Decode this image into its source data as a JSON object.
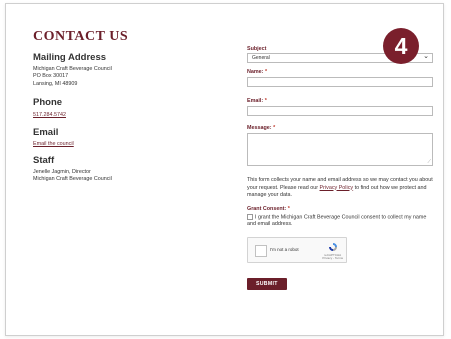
{
  "page": {
    "title": "CONTACT US",
    "badge": "4"
  },
  "contact": {
    "mailing_heading": "Mailing Address",
    "address_lines": [
      "Michigan Craft Beverage Council",
      "PO Box 30017",
      "Lansing, MI 48909"
    ],
    "phone_heading": "Phone",
    "phone": "517.284.5742",
    "email_heading": "Email",
    "email_link": "Email the council",
    "staff_heading": "Staff",
    "staff_lines": [
      "Jenelle Jagmin, Director",
      "Michigan Craft Beverage Council"
    ]
  },
  "form": {
    "subject_label": "Subject",
    "subject_value": "General",
    "name_label": "Name:",
    "email_label": "Email:",
    "message_label": "Message:",
    "required_mark": "*",
    "privacy_text_before": "This form collects your name and email address so we may contact you about your request. Please read our ",
    "privacy_link": "Privacy Policy",
    "privacy_text_after": " to find out how we protect and manage your data.",
    "consent_label": "Grant Consent:",
    "consent_text": "I grant the Michigan Craft Beverage Council consent to collect my name and email address.",
    "recaptcha_text": "I'm not a robot",
    "recaptcha_brand": "reCAPTCHA",
    "recaptcha_terms": "Privacy - Terms",
    "submit_label": "SUBMIT"
  },
  "colors": {
    "accent": "#6b1f2a",
    "badge": "#7a1f2c"
  }
}
